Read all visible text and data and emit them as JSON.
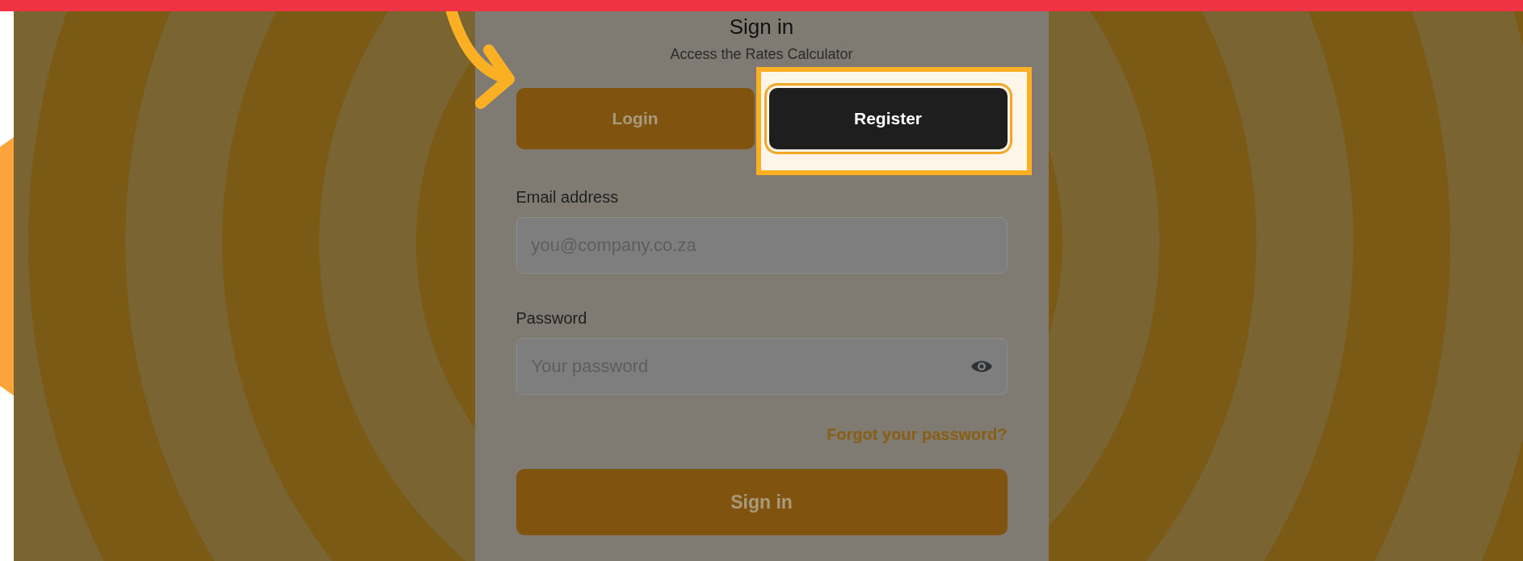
{
  "heading": "Sign in",
  "subtitle": "Access the Rates Calculator",
  "tabs": [
    {
      "label": "Login",
      "highlighted": false
    },
    {
      "label": "Register",
      "highlighted": true
    }
  ],
  "email": {
    "label": "Email address",
    "placeholder": "you@company.co.za"
  },
  "password": {
    "label": "Password",
    "placeholder": "Your password"
  },
  "forgot_link": "Forgot your password?",
  "submit_button": "Sign in"
}
